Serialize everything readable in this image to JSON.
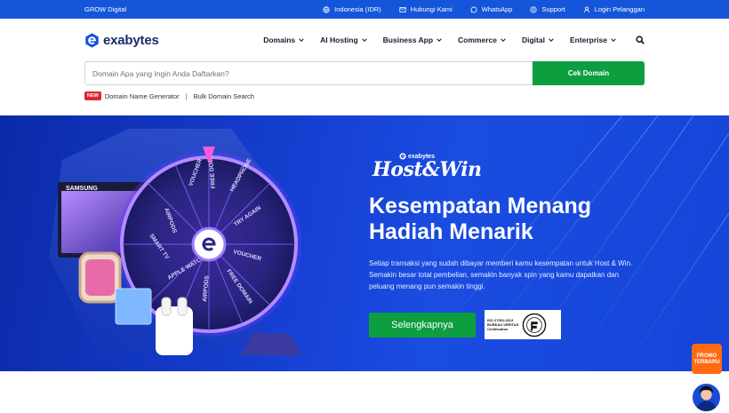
{
  "topbar": {
    "brand": "GROW Digital",
    "links": [
      {
        "label": "Indonesia (IDR)",
        "icon": "globe-icon"
      },
      {
        "label": "Hubungi Kami",
        "icon": "mail-icon"
      },
      {
        "label": "WhatsApp",
        "icon": "whatsapp-icon"
      },
      {
        "label": "Support",
        "icon": "help-icon"
      },
      {
        "label": "Login Pelanggan",
        "icon": "user-icon"
      }
    ]
  },
  "nav": {
    "logo": "exabytes",
    "menu": [
      "Domains",
      "AI Hosting",
      "Business App",
      "Commerce",
      "Digital",
      "Enterprise"
    ]
  },
  "search": {
    "placeholder": "Domain Apa yang Ingin Anda Daftarkan?",
    "button": "Cek Domain",
    "badge": "NEW",
    "links": [
      "Domain Name Generator",
      "Bulk Domain Search"
    ]
  },
  "hero": {
    "brand": "exabytes",
    "promo_title": "Host&Win",
    "headline_1": "Kesempatan Menang",
    "headline_2": "Hadiah Menarik",
    "description": "Setiap transaksi yang sudah dibayar memberi kamu kesempatan untuk Host & Win. Semakin besar total pembelian, semakin banyak spin yang kamu dapatkan dan peluang menang pun semakin tinggi.",
    "cta": "Selengkapnya",
    "cert_lines": [
      "ISO 27001:2013",
      "BUREAU VERITAS",
      "Certification"
    ],
    "wheel_labels": [
      "VOUCHER",
      "FREE DOMAIN",
      "HEADPHONE",
      "TRY AGAIN",
      "VOUCHER",
      "FREE DOMAIN",
      "AIRPODS",
      "APPLE WATCH",
      "SMART TV",
      "AIRPODS"
    ],
    "tv_brand": "SAMSUNG"
  },
  "floating": {
    "promo": [
      "PROMO",
      "TERBARU"
    ]
  },
  "colors": {
    "topbar": "#1455d9",
    "primary_green": "#0d9e3f",
    "hero_blue": "#1742d6",
    "badge_red": "#e1252f"
  }
}
